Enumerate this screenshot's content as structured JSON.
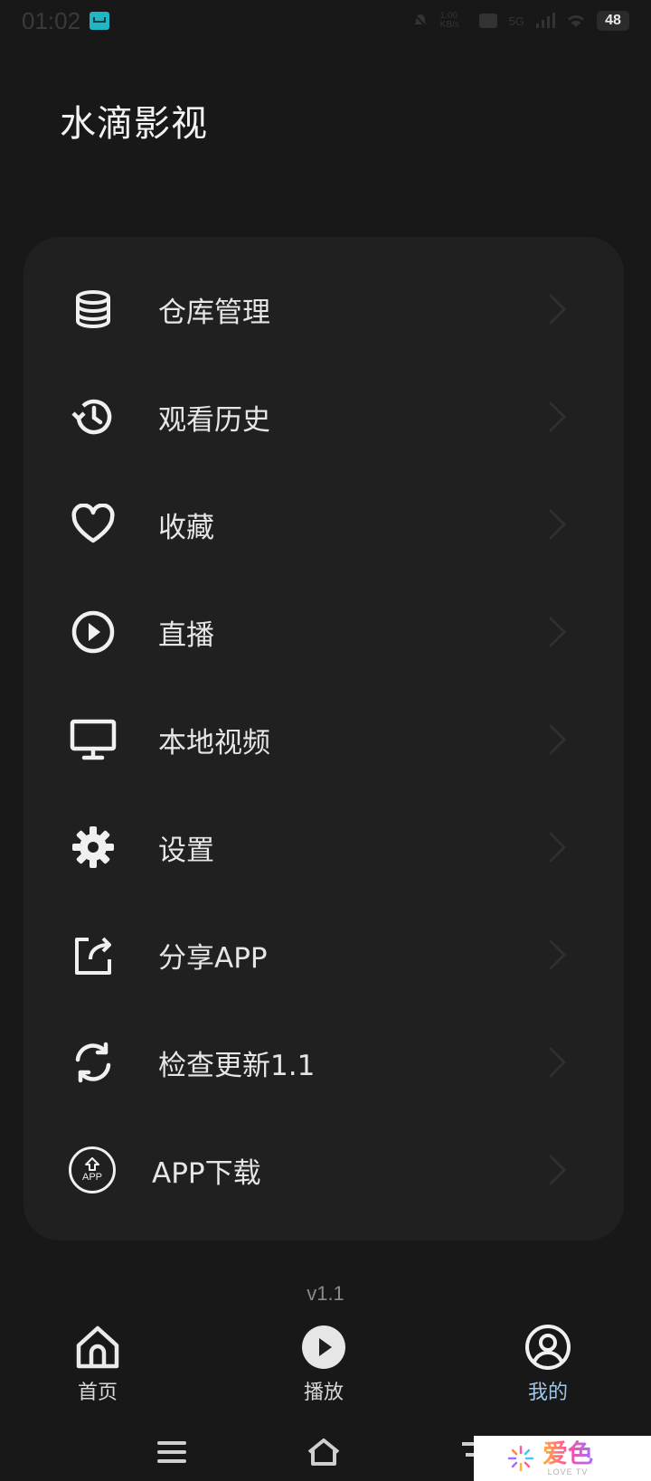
{
  "status_bar": {
    "time": "01:02",
    "speed": "1.00 KB/s",
    "network": "5G",
    "battery": "48"
  },
  "app_title": "水滴影视",
  "menu": {
    "items": [
      {
        "label": "仓库管理",
        "icon": "database-icon"
      },
      {
        "label": "观看历史",
        "icon": "history-icon"
      },
      {
        "label": "收藏",
        "icon": "heart-icon"
      },
      {
        "label": "直播",
        "icon": "play-circle-icon"
      },
      {
        "label": "本地视频",
        "icon": "monitor-icon"
      },
      {
        "label": "设置",
        "icon": "gear-icon"
      },
      {
        "label": "分享APP",
        "icon": "share-icon"
      },
      {
        "label": "检查更新1.1",
        "icon": "refresh-icon"
      },
      {
        "label": "APP下载",
        "icon": "app-download-icon",
        "icon_text": "APP"
      }
    ]
  },
  "version": "v1.1",
  "bottom_nav": {
    "items": [
      {
        "label": "首页",
        "icon": "home-icon",
        "active": false
      },
      {
        "label": "播放",
        "icon": "play-icon",
        "active": false
      },
      {
        "label": "我的",
        "icon": "profile-icon",
        "active": true
      }
    ],
    "active_color": "#9fc6ea"
  },
  "watermark": {
    "main": "爱色",
    "sub": "LOVE TV"
  }
}
